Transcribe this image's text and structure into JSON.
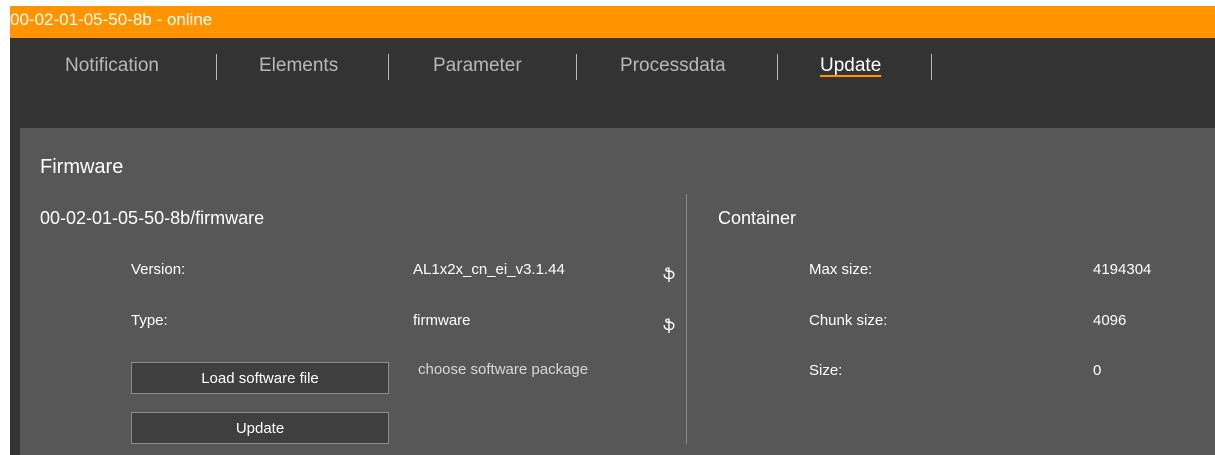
{
  "window": {
    "title": "00-02-01-05-50-8b - online",
    "accent_color": "#ff9400"
  },
  "tabs": [
    {
      "label": "Notification"
    },
    {
      "label": "Elements"
    },
    {
      "label": "Parameter"
    },
    {
      "label": "Processdata"
    },
    {
      "label": "Update",
      "active": true
    }
  ],
  "firmware": {
    "section_title": "Firmware",
    "device_path": "00-02-01-05-50-8b/firmware",
    "fields": [
      {
        "label": "Version:",
        "value": "AL1x2x_cn_ei_v3.1.44",
        "refresh_icon": "refresh-icon",
        "refresh_glyph": "ֆ"
      },
      {
        "label": "Type:",
        "value": "firmware",
        "refresh_icon": "refresh-icon",
        "refresh_glyph": "ֆ"
      }
    ],
    "load_button_label": "Load software file",
    "load_hint": "choose software package",
    "update_button_label": "Update"
  },
  "container": {
    "title": "Container",
    "fields": [
      {
        "label": "Max size:",
        "value": "4194304"
      },
      {
        "label": "Chunk size:",
        "value": "4096"
      },
      {
        "label": "Size:",
        "value": "0"
      }
    ]
  }
}
